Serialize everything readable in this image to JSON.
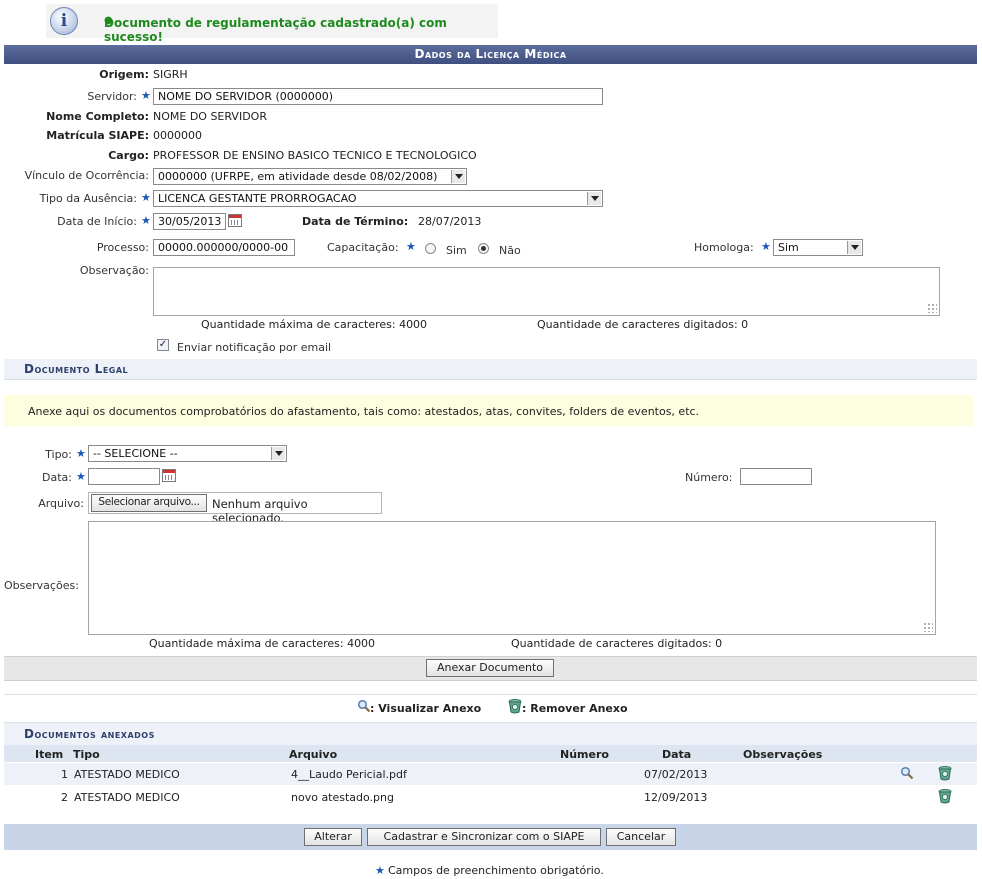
{
  "message": {
    "text": "Documento de regulamentação cadastrado(a) com sucesso!"
  },
  "header": {
    "title": "Dados da Licença Médica"
  },
  "form": {
    "origem_label": "Origem:",
    "origem_value": "SIGRH",
    "servidor_label": "Servidor:",
    "servidor_value": "NOME DO SERVIDOR (0000000)",
    "nome_label": "Nome Completo:",
    "nome_value": "NOME DO SERVIDOR",
    "matricula_label": "Matrícula SIAPE:",
    "matricula_value": "0000000",
    "cargo_label": "Cargo:",
    "cargo_value": "PROFESSOR DE ENSINO BASICO TECNICO E TECNOLOGICO",
    "vinculo_label": "Vínculo de Ocorrência:",
    "vinculo_value": "0000000 (UFRPE, em atividade desde 08/02/2008)",
    "tipo_label": "Tipo da Ausência:",
    "tipo_value": "LICENCA GESTANTE PRORROGACAO",
    "inicio_label": "Data de Início:",
    "inicio_value": "30/05/2013",
    "termino_label": "Data de Término:",
    "termino_value": "28/07/2013",
    "processo_label": "Processo:",
    "processo_value": "00000.000000/0000-00",
    "capacitacao_label": "Capacitação:",
    "sim_label": "Sim",
    "nao_label": "Não",
    "homologa_label": "Homologa:",
    "homologa_value": "Sim",
    "observacao_label": "Observação:",
    "max_chars": "Quantidade máxima de caracteres: 4000",
    "typed_chars": "Quantidade de caracteres digitados: 0",
    "notify_label": "Enviar notificação por email"
  },
  "doc": {
    "title": "Documento Legal",
    "info": "Anexe aqui os documentos comprobatórios do afastamento, tais como: atestados, atas, convites, folders de eventos, etc.",
    "tipo_label": "Tipo:",
    "tipo_value": "-- SELECIONE --",
    "data_label": "Data:",
    "numero_label": "Número:",
    "arquivo_label": "Arquivo:",
    "file_button": "Selecionar arquivo...",
    "file_status": "Nenhum arquivo selecionado.",
    "obs_label": "Observações:",
    "max_chars": "Quantidade máxima de caracteres: 4000",
    "typed_chars": "Quantidade de caracteres digitados: 0",
    "attach_button": "Anexar Documento"
  },
  "legend": {
    "view": ": Visualizar Anexo",
    "remove": ": Remover Anexo"
  },
  "attached": {
    "title": "Documentos anexados",
    "headers": {
      "item": "Item",
      "tipo": "Tipo",
      "arquivo": "Arquivo",
      "numero": "Número",
      "data": "Data",
      "obs": "Observações"
    },
    "rows": [
      {
        "item": "1",
        "tipo": "ATESTADO MEDICO",
        "arquivo": "4__Laudo Pericial.pdf",
        "numero": "",
        "data": "07/02/2013",
        "obs": ""
      },
      {
        "item": "2",
        "tipo": "ATESTADO MEDICO",
        "arquivo": "novo atestado.png",
        "numero": "",
        "data": "12/09/2013",
        "obs": ""
      }
    ]
  },
  "actions": {
    "alterar": "Alterar",
    "cadastrar": "Cadastrar e Sincronizar com o SIAPE",
    "cancelar": "Cancelar"
  },
  "footer": {
    "required": "Campos de preenchimento obrigatório."
  },
  "colors": {
    "header_bar": "#4a5a8a",
    "message_green": "#1e8a1e",
    "section_bg": "#eef2f8",
    "info_bg": "#fdfde0",
    "button_bar": "#c8d4e8"
  }
}
